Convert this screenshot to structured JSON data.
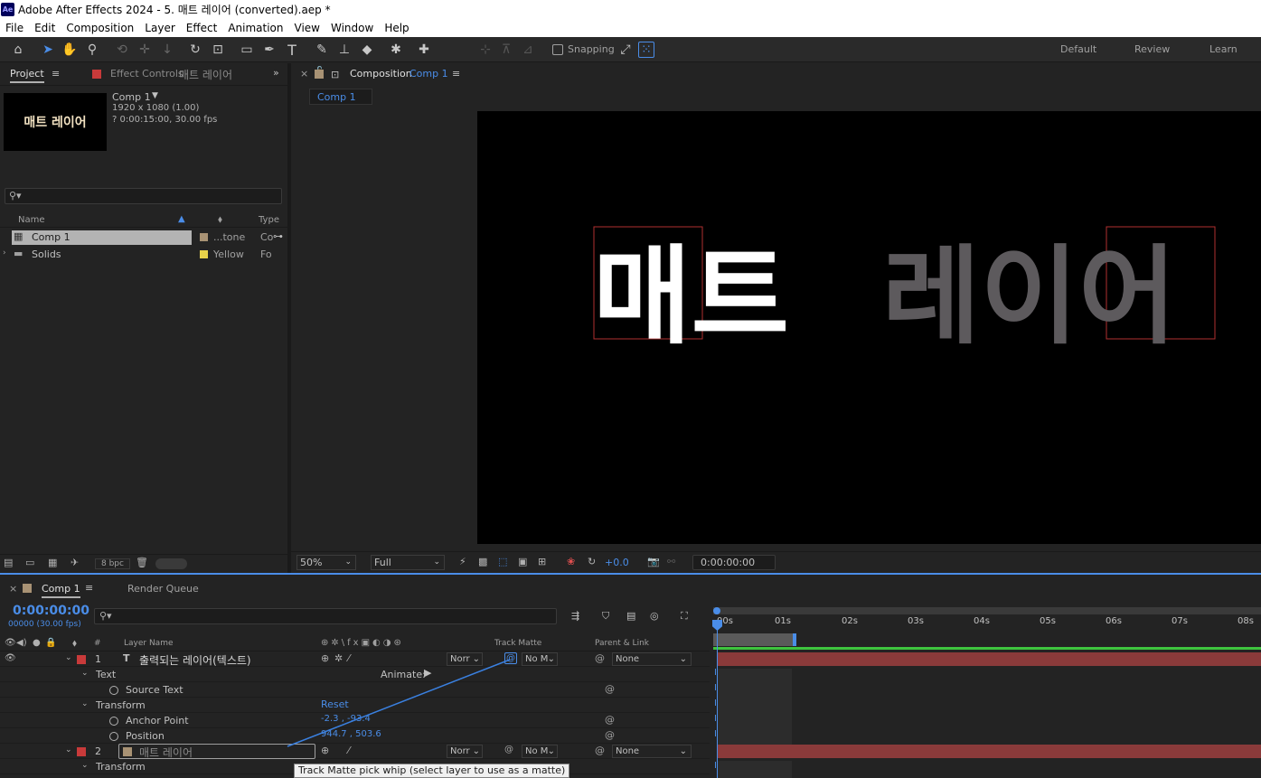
{
  "window": {
    "title": "Adobe After Effects 2024 - 5. 매트 레이어 (converted).aep *",
    "logo": "Ae"
  },
  "menu": [
    "File",
    "Edit",
    "Composition",
    "Layer",
    "Effect",
    "Animation",
    "View",
    "Window",
    "Help"
  ],
  "toolbar": {
    "snapping_label": "Snapping",
    "workspaces": [
      "Default",
      "Review",
      "Learn"
    ]
  },
  "project_panel": {
    "tab_project": "Project",
    "tab_effect_controls": "Effect Controls",
    "effect_controls_target": "매트 레이어",
    "thumbnail_text": "매트 레이어",
    "item_name": "Comp 1",
    "item_dims": "1920 x 1080 (1.00)",
    "item_duration": "? 0:00:15:00, 30.00 fps",
    "col_name": "Name",
    "col_type": "Type",
    "items": [
      {
        "name": "Comp 1",
        "label": "...tone",
        "type": "Co",
        "label_color": "#a89274"
      },
      {
        "name": "Solids",
        "label": "Yellow",
        "type": "Fo",
        "label_color": "#e8d24a"
      }
    ],
    "bpc": "8 bpc"
  },
  "comp_panel": {
    "tab_prefix": "Composition",
    "tab_name": "Comp 1",
    "breadcrumb": "Comp 1",
    "viewer_text_left": "매트",
    "viewer_text_right": "레이어",
    "zoom": "50%",
    "resolution": "Full",
    "exposure": "+0.0",
    "timecode": "0:00:00:00"
  },
  "timeline": {
    "tab_comp": "Comp 1",
    "tab_render": "Render Queue",
    "current_time": "0:00:00:00",
    "frame_info": "00000 (30.00 fps)",
    "col_layer_name": "Layer Name",
    "col_num": "#",
    "col_track_matte": "Track Matte",
    "col_parent": "Parent & Link",
    "ruler": [
      "00s",
      "01s",
      "02s",
      "03s",
      "04s",
      "05s",
      "06s",
      "07s",
      "08s"
    ],
    "layers": [
      {
        "num": "1",
        "name": "출력되는 레이어(텍스트)",
        "mode": "Norr",
        "matte": "No M",
        "parent": "None",
        "label_color": "#c83a3a"
      },
      {
        "num": "2",
        "name": "매트 레이어",
        "mode": "Norr",
        "matte": "No M",
        "parent": "None",
        "label_color": "#c83a3a"
      }
    ],
    "props": {
      "text": "Text",
      "animate": "Animate:",
      "source_text": "Source Text",
      "transform": "Transform",
      "reset": "Reset",
      "anchor_point": "Anchor Point",
      "anchor_value": "-2.3 , -93.4",
      "position": "Position",
      "position_value": "944.7 , 503.6",
      "transform2": "Transform"
    },
    "tooltip": "Track Matte pick whip (select layer to use as a matte)"
  }
}
